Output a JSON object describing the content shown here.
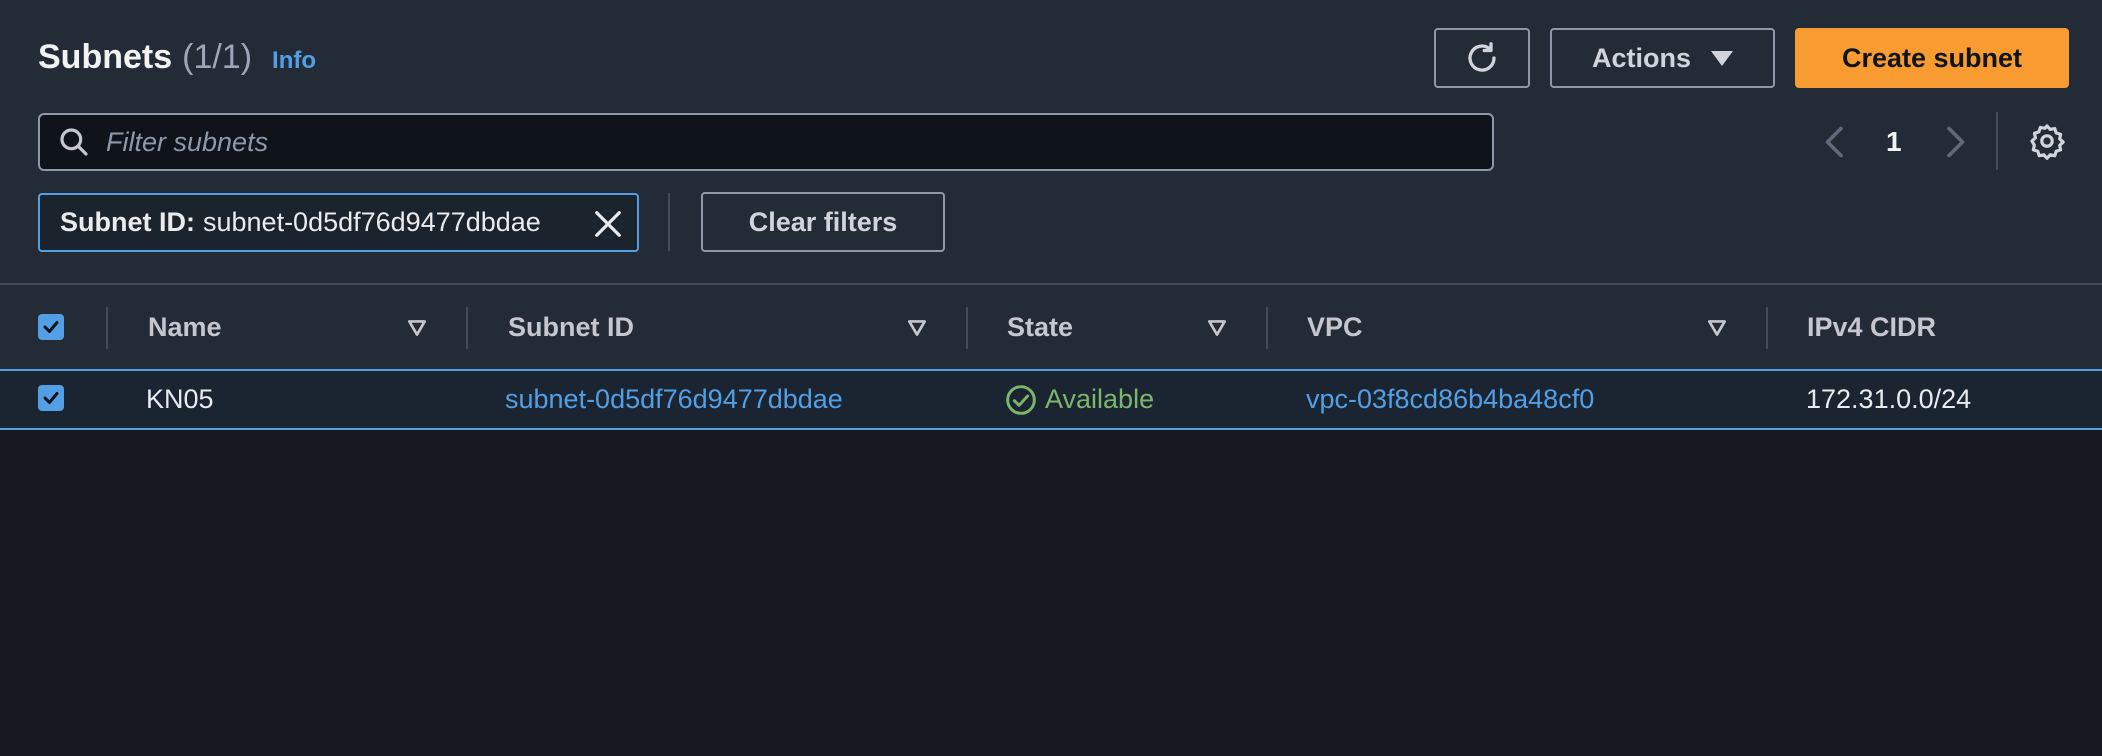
{
  "header": {
    "title": "Subnets",
    "count": "(1/1)",
    "info_label": "Info",
    "actions_label": "Actions",
    "create_label": "Create subnet"
  },
  "filter": {
    "placeholder": "Filter subnets",
    "value": "",
    "token_key": "Subnet ID:",
    "token_value": "subnet-0d5df76d9477dbdae",
    "clear_label": "Clear filters"
  },
  "pagination": {
    "current_page": "1"
  },
  "table": {
    "columns": [
      "Name",
      "Subnet ID",
      "State",
      "VPC",
      "IPv4 CIDR"
    ],
    "rows": [
      {
        "selected": true,
        "name": "KN05",
        "subnet_id": "subnet-0d5df76d9477dbdae",
        "state": "Available",
        "vpc": "vpc-03f8cd86b4ba48cf0",
        "ipv4_cidr": "172.31.0.0/24"
      }
    ]
  },
  "icons": {
    "refresh": "refresh-icon",
    "search": "search-icon",
    "settings": "gear-icon",
    "close": "close-icon",
    "sort": "sort-caret-icon",
    "status": "check-circle-icon"
  },
  "colors": {
    "primary_button": "#f89c32",
    "link": "#539fe5",
    "status_available": "#7bb66a",
    "background": "#232b37"
  }
}
